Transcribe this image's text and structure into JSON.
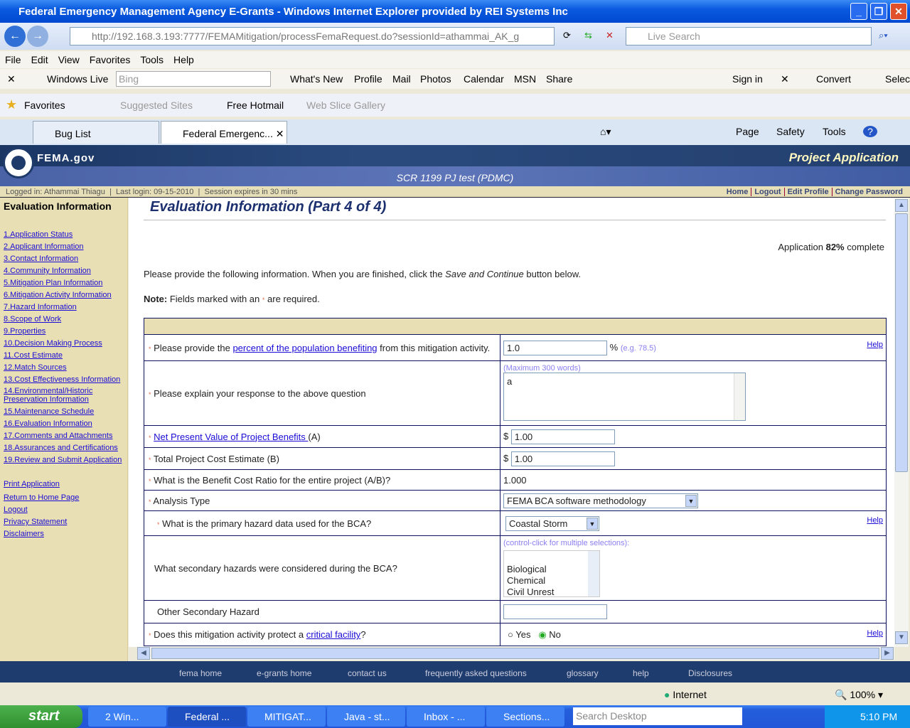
{
  "browser": {
    "title": "Federal Emergency Management Agency E-Grants - Windows Internet Explorer provided by REI Systems Inc",
    "url_host": "http://192.168.3.193",
    ":url_rest": "",
    "url_rest": ":7777/FEMAMitigation/processFemaRequest.do?sessionId=athammai_AK_g",
    "live_search_placeholder": "Live Search",
    "menu": [
      "File",
      "Edit",
      "View",
      "Favorites",
      "Tools",
      "Help"
    ],
    "wl_toolbar": {
      "brand": "Windows Live",
      "search_placeholder": "Bing",
      "items": [
        "What's New",
        "Profile",
        "Mail",
        "Photos",
        "Calendar",
        "MSN",
        "Share"
      ],
      "sign_in": "Sign in",
      "convert": "Convert",
      "select": "Selec"
    },
    "favorites_bar": {
      "favorites": "Favorites",
      "items": [
        "Suggested Sites",
        "Free Hotmail",
        "Web Slice Gallery"
      ]
    },
    "tabs": [
      "Bug List",
      "Federal Emergenc..."
    ],
    "commands": [
      "Page",
      "Safety",
      "Tools"
    ],
    "status": {
      "zone": "Internet",
      "zoom": "100%"
    }
  },
  "header": {
    "logo": "FEMA.gov",
    "section": "Project Application",
    "project": "SCR 1199 PJ test (PDMC)",
    "logged_in": "Logged in: Athammai Thiagu",
    "last_login": "Last login: 09-15-2010",
    "session": "Session expires in 30 mins",
    "links": [
      "Home",
      "Logout",
      "Edit Profile",
      "Change Password"
    ]
  },
  "sidebar": {
    "title": "Evaluation Information",
    "items": [
      "1.Application Status",
      "2.Applicant Information",
      "3.Contact Information",
      "4.Community Information",
      "5.Mitigation Plan Information",
      "6.Mitigation Activity Information",
      "7.Hazard Information",
      "8.Scope of Work",
      "9.Properties",
      "10.Decision Making Process",
      "11.Cost Estimate",
      "12.Match Sources",
      "13.Cost Effectiveness Information",
      "14.Environmental/Historic Preservation Information",
      "15.Maintenance Schedule",
      "16.Evaluation Information",
      "17.Comments and Attachments",
      "18.Assurances and Certifications",
      "19.Review and Submit Application"
    ],
    "links": [
      "Print Application",
      "Return to Home Page",
      "Logout",
      "Privacy Statement",
      "Disclaimers"
    ]
  },
  "main": {
    "title": "Evaluation Information (Part 4 of 4)",
    "progress_pre": "Application ",
    "progress": "82%",
    "progress_post": " complete",
    "instr_pre": "Please provide the following information. When you are finished, click the ",
    "instr_em": "Save and Continue",
    "instr_post": " button below.",
    "note_label": "Note:",
    "note_text": " Fields marked with an ",
    "note_end": " are required.",
    "req": "*",
    "help": "Help",
    "q1_pre": "Please provide the ",
    "q1_link": "percent of the population benefiting",
    "q1_post": " from this mitigation activity.",
    "q1_value": "1.0",
    "q1_unit": "%",
    "q1_hint": "(e.g. 78.5)",
    "q2": "Please explain your response to the above question",
    "q2_hint": "(Maximum 300 words)",
    "q2_value": "a",
    "q3_link": "Net Present Value of Project Benefits ",
    "q3_post": "(A)",
    "q3_value": "1.00",
    "currency": "$",
    "q4": "Total Project Cost Estimate (B)",
    "q4_value": "1.00",
    "q5": "What is the Benefit Cost Ratio for the entire project (A/B)?",
    "q5_value": "1.000",
    "q6": "Analysis Type",
    "q6_value": "FEMA BCA software methodology",
    "q7": "What is the primary hazard data used for the BCA?",
    "q7_value": "Coastal Storm",
    "q8": "What secondary hazards were considered during the BCA?",
    "q8_hint": "(control-click for multiple selections):",
    "q8_options": [
      "Biological",
      "Chemical",
      "Civil Unrest"
    ],
    "q9": "Other Secondary Hazard",
    "q9_value": "",
    "q10_pre": "Does this mitigation activity protect a ",
    "q10_link": "critical facility",
    "q10_post": "?",
    "yes": "Yes",
    "no": "No",
    "q10_selected": "No"
  },
  "footer": [
    "fema home",
    "e-grants home",
    "contact us",
    "frequently asked questions",
    "glossary",
    "help",
    "Disclosures"
  ],
  "taskbar": {
    "start": "start",
    "tasks": [
      "2 Win...",
      "Federal ...",
      "MITIGAT...",
      "Java - st...",
      "Inbox - ...",
      "Sections..."
    ],
    "search_placeholder": "Search Desktop",
    "clock": "5:10 PM"
  }
}
